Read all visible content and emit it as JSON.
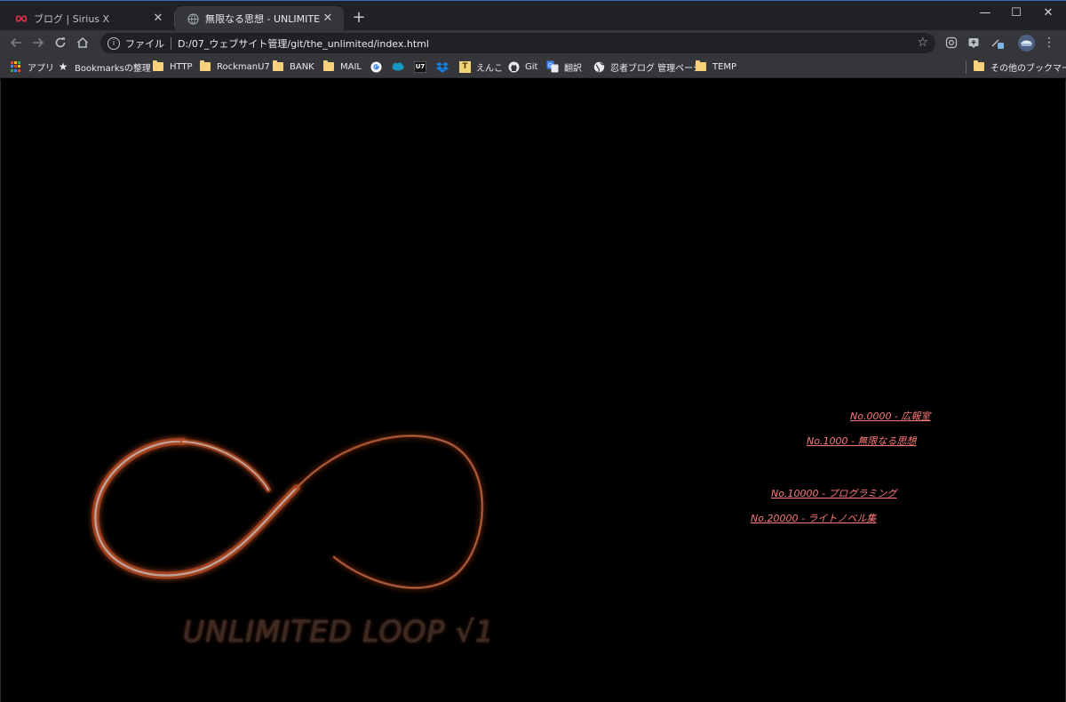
{
  "tabs": [
    {
      "title": "ブログ | Sirius X",
      "close": "✕"
    },
    {
      "title": "無限なる思想 - UNLIMITED LOOP",
      "close": "✕"
    }
  ],
  "new_tab": "+",
  "window_controls": {
    "minimize": "—",
    "maximize": "☐",
    "close": "✕"
  },
  "omnibox": {
    "scheme_label": "ファイル",
    "url": "D:/07_ウェブサイト管理/git/the_unlimited/index.html",
    "info": "i"
  },
  "bookmarks": [
    {
      "label": "アプリ",
      "icon": "apps-grid-icon"
    },
    {
      "label": "Bookmarksの整理",
      "icon": "star-icon"
    },
    {
      "label": "HTTP",
      "icon": "folder-icon"
    },
    {
      "label": "RockmanU7",
      "icon": "folder-icon"
    },
    {
      "label": "BANK",
      "icon": "folder-icon"
    },
    {
      "label": "MAIL",
      "icon": "folder-icon"
    },
    {
      "label": "",
      "icon": "google-icon"
    },
    {
      "label": "",
      "icon": "salesforce-icon"
    },
    {
      "label": "",
      "icon": "u7-icon",
      "text": "U7"
    },
    {
      "label": "",
      "icon": "dropbox-icon"
    },
    {
      "label": "えんこ",
      "icon": "enko-icon"
    },
    {
      "label": "Git",
      "icon": "github-icon"
    },
    {
      "label": "翻訳",
      "icon": "translate-icon"
    },
    {
      "label": "忍者ブログ 管理ページ",
      "icon": "globe-icon"
    },
    {
      "label": "TEMP",
      "icon": "folder-icon"
    },
    {
      "label": "その他のブックマーク",
      "icon": "folder-icon"
    }
  ],
  "page": {
    "brand": "UNLIMITED LOOP √1",
    "links": [
      {
        "label": "No.0000 - 広報室"
      },
      {
        "label": "No.1000 - 無限なる思想"
      },
      {
        "label": "No.10000 - プログラミング"
      },
      {
        "label": "No.20000 - ライトノベル集"
      }
    ],
    "colors": {
      "link": "#ff7a7a",
      "loop_glow": "#b54a22",
      "background": "#000000"
    }
  }
}
